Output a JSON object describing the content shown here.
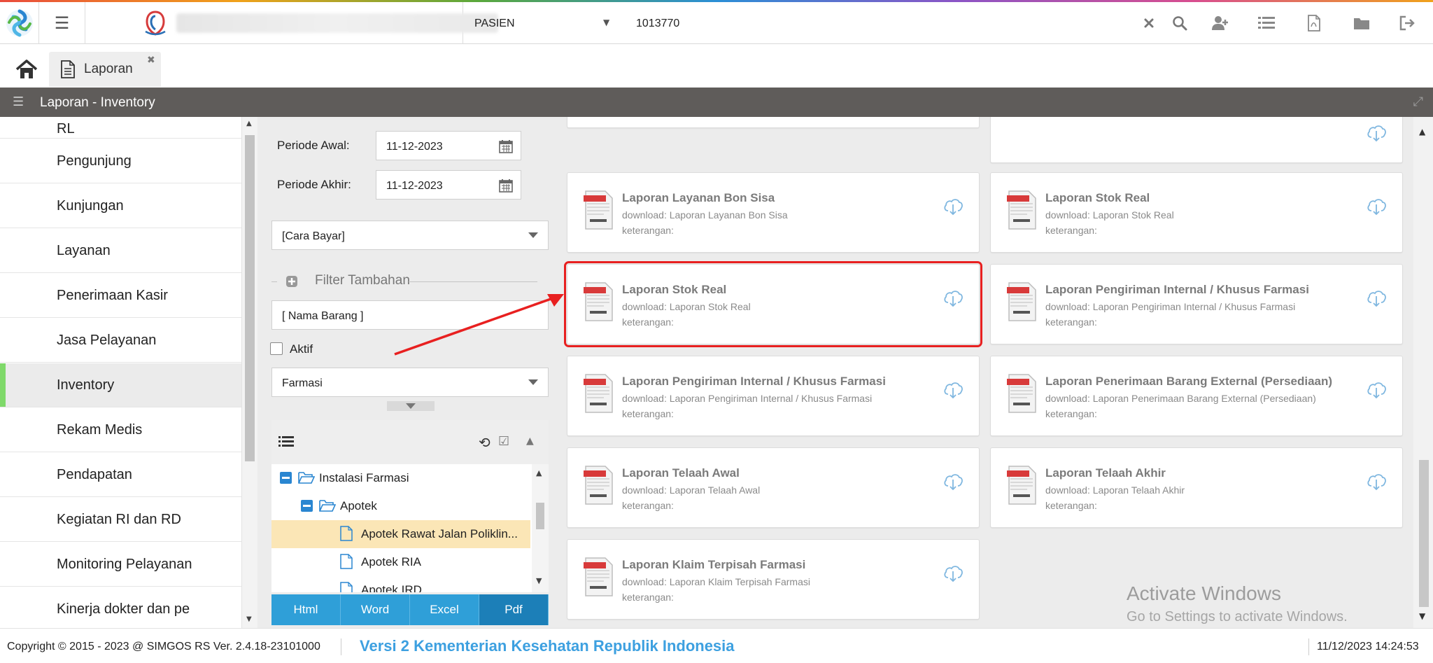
{
  "header": {
    "search_type": "PASIEN",
    "search_value": "1013770",
    "icons": [
      "clear-icon",
      "search-icon",
      "add-user-icon",
      "list-icon",
      "pdf-icon",
      "folder-icon",
      "logout-icon"
    ]
  },
  "tabs": [
    {
      "label": "Laporan"
    }
  ],
  "titlebar": {
    "title": "Laporan - Inventory"
  },
  "nav": {
    "items": [
      {
        "label": "RL"
      },
      {
        "label": "Pengunjung"
      },
      {
        "label": "Kunjungan"
      },
      {
        "label": "Layanan"
      },
      {
        "label": "Penerimaan Kasir"
      },
      {
        "label": "Jasa Pelayanan"
      },
      {
        "label": "Inventory",
        "active": true
      },
      {
        "label": "Rekam Medis"
      },
      {
        "label": "Pendapatan"
      },
      {
        "label": "Kegiatan RI dan RD"
      },
      {
        "label": "Monitoring Pelayanan"
      },
      {
        "label": "Kinerja dokter dan pe"
      }
    ]
  },
  "filter": {
    "periode_awal_label": "Periode Awal:",
    "periode_awal_value": "11-12-2023",
    "periode_akhir_label": "Periode Akhir:",
    "periode_akhir_value": "11-12-2023",
    "cara_bayar": "[Cara Bayar]",
    "filter_tambahan": "Filter Tambahan",
    "nama_barang": "[ Nama Barang ]",
    "aktif_label": "Aktif",
    "jenis": "Farmasi"
  },
  "tree": {
    "rows": [
      {
        "label": "Instalasi Farmasi"
      },
      {
        "label": "Apotek"
      },
      {
        "label": "Apotek Rawat Jalan Poliklin..."
      },
      {
        "label": "Apotek RIA"
      },
      {
        "label": "Apotek IRD"
      }
    ]
  },
  "export": {
    "html": "Html",
    "word": "Word",
    "excel": "Excel",
    "pdf": "Pdf"
  },
  "reports": [
    {
      "title": "Laporan Layanan Bon Sisa",
      "download": "download: Laporan Layanan Bon Sisa",
      "keterangan": "keterangan:"
    },
    {
      "title": "Laporan Stok Real",
      "download": "download: Laporan Stok Real",
      "keterangan": "keterangan:"
    },
    {
      "title": "Laporan Stok Real",
      "download": "download: Laporan Stok Real",
      "keterangan": "keterangan:"
    },
    {
      "title": "Laporan Pengiriman Internal / Khusus Farmasi",
      "download": "download: Laporan Pengiriman Internal / Khusus Farmasi",
      "keterangan": "keterangan:"
    },
    {
      "title": "Laporan Pengiriman Internal / Khusus Farmasi",
      "download": "download: Laporan Pengiriman Internal / Khusus Farmasi",
      "keterangan": "keterangan:"
    },
    {
      "title": "Laporan Penerimaan Barang External (Persediaan)",
      "download": "download: Laporan Penerimaan Barang External (Persediaan)",
      "keterangan": "keterangan:"
    },
    {
      "title": "Laporan Telaah Awal",
      "download": "download: Laporan Telaah Awal",
      "keterangan": "keterangan:"
    },
    {
      "title": "Laporan Telaah Akhir",
      "download": "download: Laporan Telaah Akhir",
      "keterangan": "keterangan:"
    },
    {
      "title": "Laporan Klaim Terpisah Farmasi",
      "download": "download: Laporan Klaim Terpisah Farmasi",
      "keterangan": "keterangan:"
    }
  ],
  "watermark": {
    "line1": "Activate Windows",
    "line2": "Go to Settings to activate Windows."
  },
  "footer": {
    "copyright": "Copyright © 2015 - 2023 @ SIMGOS RS Ver. 2.4.18-23101000",
    "version": "Versi 2 Kementerian Kesehatan Republik Indonesia",
    "datetime": "11/12/2023 14:24:53"
  },
  "colors": {
    "titlebar": "#5f5c5a",
    "nav_active_accent": "#7fd96a",
    "export_button": "#2f9fd8",
    "highlight": "#e82020",
    "version_text": "#3da0e0"
  }
}
